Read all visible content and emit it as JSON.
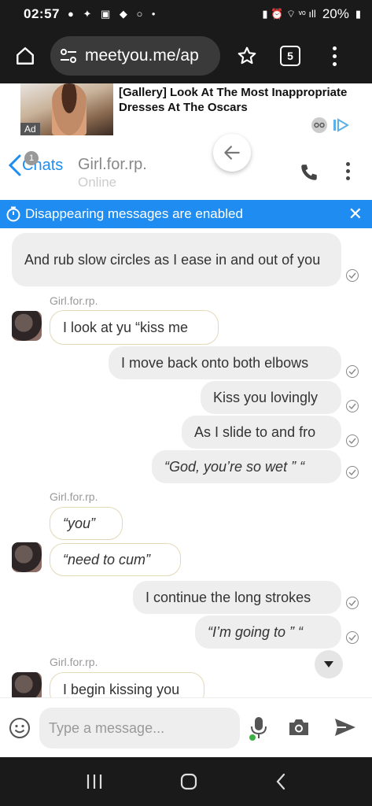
{
  "status_bar": {
    "time": "02:57",
    "battery": "20%"
  },
  "browser": {
    "url": "meetyou.me/ap",
    "tab_count": "5"
  },
  "ad": {
    "title": "[Gallery] Look At The Most Inappropriate Dresses At The Oscars",
    "label": "Ad"
  },
  "chat_header": {
    "back_label": "Chats",
    "unread_badge": "1",
    "contact_name": "Girl.for.rp.",
    "contact_status": "Online"
  },
  "banner": {
    "text": "Disappearing messages are enabled"
  },
  "messages": [
    {
      "dir": "out",
      "text": "And rub slow circles as I ease in and out of you",
      "italic": false
    },
    {
      "dir": "sender",
      "text": "Girl.for.rp."
    },
    {
      "dir": "in",
      "text": "I look at yu  “kiss me",
      "italic": false
    },
    {
      "dir": "out",
      "text": "I move back onto both elbows",
      "italic": false
    },
    {
      "dir": "out",
      "text": "Kiss you lovingly",
      "italic": false
    },
    {
      "dir": "out",
      "text": "As I slide to and fro",
      "italic": false
    },
    {
      "dir": "out",
      "text": "“God, you’re so wet ”  “",
      "italic": true
    },
    {
      "dir": "sender",
      "text": "Girl.for.rp."
    },
    {
      "dir": "in",
      "text": "“you”",
      "italic": true
    },
    {
      "dir": "in",
      "text": "“need to cum”",
      "italic": true
    },
    {
      "dir": "out",
      "text": "I continue the long strokes",
      "italic": false
    },
    {
      "dir": "out",
      "text": "“I’m going to ”  “",
      "italic": true
    },
    {
      "dir": "sender",
      "text": "Girl.for.rp."
    },
    {
      "dir": "in",
      "text": "I begin kissing you",
      "italic": false
    }
  ],
  "composer": {
    "placeholder": "Type a message..."
  },
  "colors": {
    "accent": "#1e8cf0",
    "bubble_out": "#eeeeee",
    "bubble_in_border": "#e2d9b8"
  },
  "icons": [
    "home-icon",
    "tune-icon",
    "star-icon",
    "tabs-icon",
    "more-vert-icon",
    "back-arrow-icon",
    "phone-icon",
    "timer-icon",
    "close-icon",
    "check-icon",
    "chevron-down-icon",
    "emoji-icon",
    "mic-icon",
    "camera-icon",
    "send-icon",
    "recents-icon",
    "home-nav-icon",
    "back-nav-icon"
  ]
}
